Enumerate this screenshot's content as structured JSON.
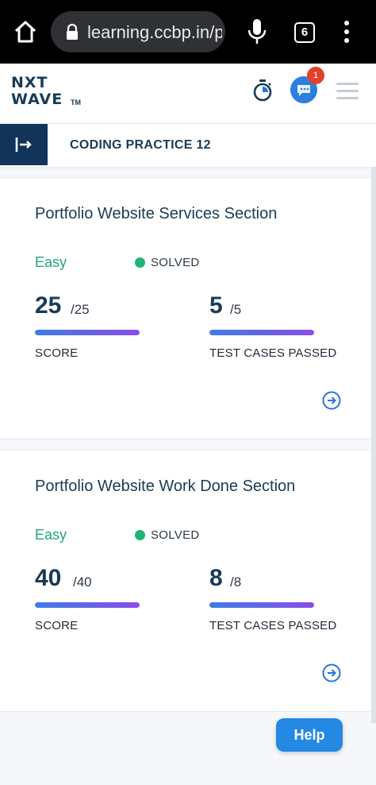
{
  "browser": {
    "url": "learning.ccbp.in/p",
    "tab_count": "6"
  },
  "header": {
    "logo_line1": "NXT",
    "logo_line2": "WAVE",
    "logo_tm": "TM",
    "notification_count": "1",
    "icons": {
      "timer": "stopwatch-icon",
      "chat": "chat-icon",
      "menu": "hamburger-icon"
    }
  },
  "practice": {
    "title": "CODING PRACTICE 12"
  },
  "cards": [
    {
      "title": "Portfolio Website Services Section",
      "difficulty": "Easy",
      "status": "SOLVED",
      "score": "25",
      "score_total": "/25",
      "score_label": "SCORE",
      "score_fraction": 1.0,
      "tests": "5",
      "tests_total": "/5",
      "tests_label": "TEST CASES PASSED",
      "tests_fraction": 1.0
    },
    {
      "title": "Portfolio Website Work Done Section",
      "difficulty": "Easy",
      "status": "SOLVED",
      "score": "40",
      "score_total": "/40",
      "score_label": "SCORE",
      "score_fraction": 1.0,
      "tests": "8",
      "tests_total": "/8",
      "tests_label": "TEST CASES PASSED",
      "tests_fraction": 1.0
    }
  ],
  "help": {
    "label": "Help"
  },
  "colors": {
    "brand_navy": "#183b56",
    "accent_blue": "#2389e3",
    "easy_green": "#22a476",
    "solved_green": "#21b478",
    "badge_red": "#e0412c"
  }
}
